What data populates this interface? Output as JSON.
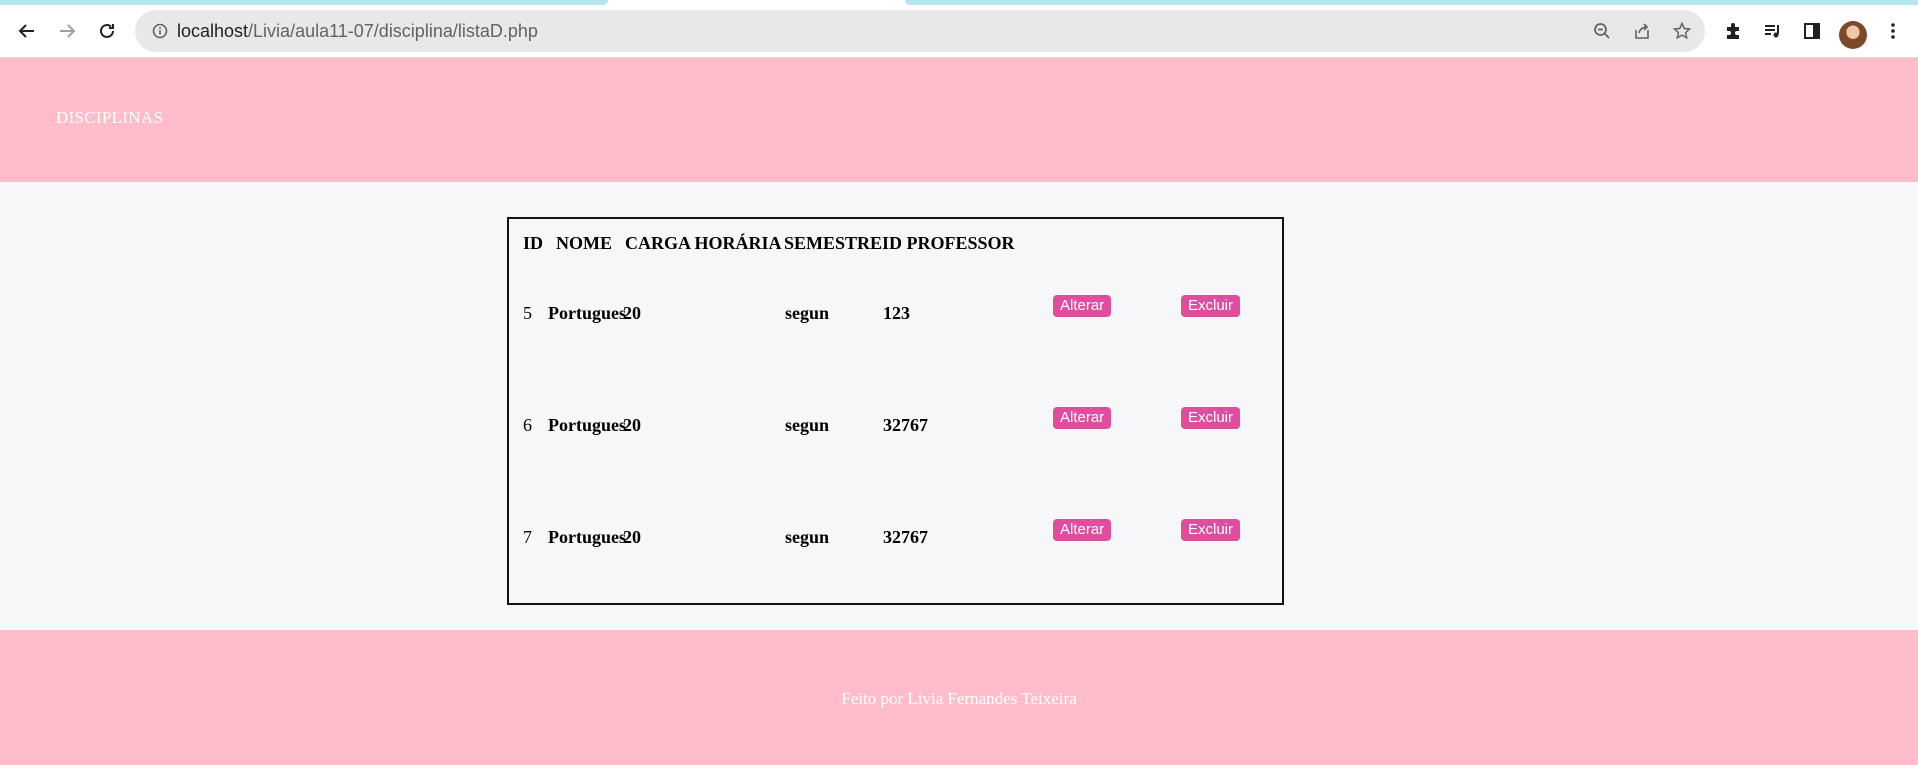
{
  "browser": {
    "url_host": "localhost",
    "url_path": "/Livia/aula11-07/disciplina/listaD.php"
  },
  "header": {
    "title": "DISCIPLINAS"
  },
  "table": {
    "columns": [
      "ID",
      "NOME",
      "CARGA HORÁRIA",
      "SEMESTRE",
      "ID PROFESSOR"
    ],
    "rows": [
      {
        "id": "5",
        "nome": "Portugues",
        "carga": "20",
        "semestre": "segun",
        "id_professor": "123",
        "alterar": "Alterar",
        "excluir": "Excluir"
      },
      {
        "id": "6",
        "nome": "Portugues",
        "carga": "20",
        "semestre": "segun",
        "id_professor": "32767",
        "alterar": "Alterar",
        "excluir": "Excluir"
      },
      {
        "id": "7",
        "nome": "Portugues",
        "carga": "20",
        "semestre": "segun",
        "id_professor": "32767",
        "alterar": "Alterar",
        "excluir": "Excluir"
      }
    ]
  },
  "footer": {
    "credit": "Feito por Livia Fernandes Teixeira"
  },
  "colors": {
    "header_bg": "#ffbdca",
    "button_bg": "#df4d9e",
    "page_bg": "#f5f7f8"
  },
  "icons": [
    "back-icon",
    "forward-icon",
    "reload-icon",
    "info-icon",
    "zoom-out-icon",
    "share-icon",
    "star-icon",
    "extensions-icon",
    "media-icon",
    "side-panel-icon",
    "menu-icon"
  ]
}
